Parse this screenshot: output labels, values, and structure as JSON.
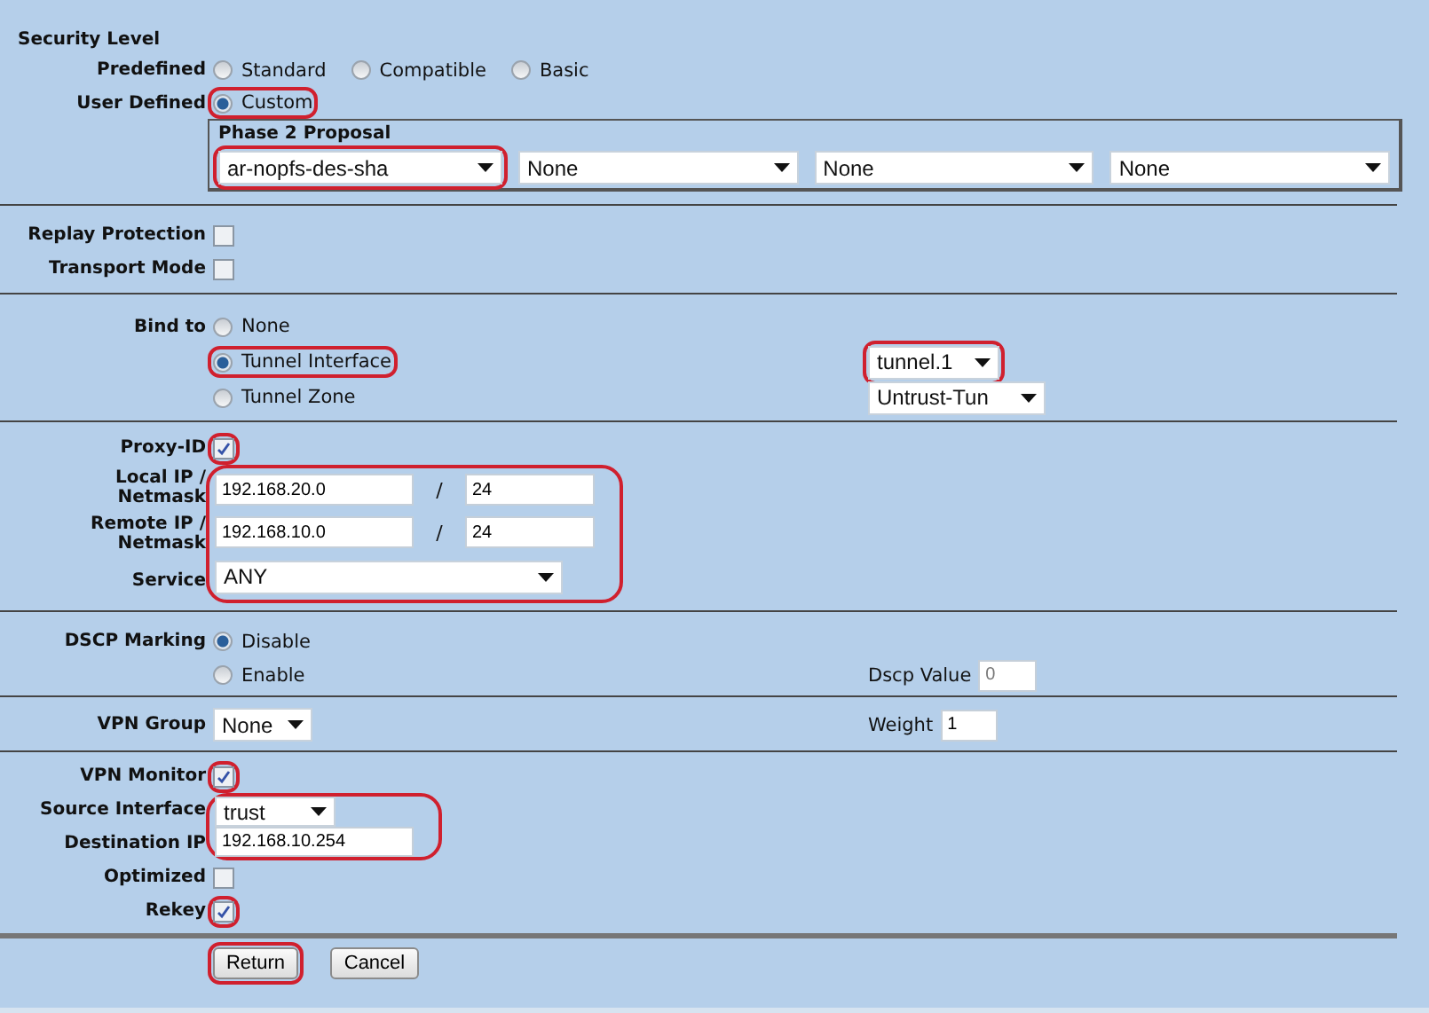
{
  "security_level": {
    "heading": "Security Level",
    "predefined": {
      "label": "Predefined",
      "options": [
        {
          "label": "Standard",
          "selected": false
        },
        {
          "label": "Compatible",
          "selected": false
        },
        {
          "label": "Basic",
          "selected": false
        }
      ]
    },
    "user_defined": {
      "label": "User Defined",
      "option": {
        "label": "Custom",
        "selected": true,
        "highlighted": true
      }
    },
    "phase2": {
      "title": "Phase 2 Proposal",
      "selects": [
        {
          "value": "ar-nopfs-des-sha",
          "highlighted": true
        },
        {
          "value": "None",
          "highlighted": false
        },
        {
          "value": "None",
          "highlighted": false
        },
        {
          "value": "None",
          "highlighted": false
        }
      ]
    }
  },
  "replay_protection": {
    "label": "Replay Protection",
    "checked": false
  },
  "transport_mode": {
    "label": "Transport Mode",
    "checked": false
  },
  "bind_to": {
    "label": "Bind to",
    "options": [
      {
        "label": "None",
        "selected": false,
        "highlighted": false
      },
      {
        "label": "Tunnel Interface",
        "selected": true,
        "highlighted": true,
        "select": {
          "value": "tunnel.1",
          "highlighted": true
        }
      },
      {
        "label": "Tunnel Zone",
        "selected": false,
        "highlighted": false,
        "select": {
          "value": "Untrust-Tun",
          "highlighted": false
        }
      }
    ]
  },
  "proxy_id": {
    "label": "Proxy-ID",
    "checked": true,
    "highlighted": true,
    "fields_highlighted": true,
    "local": {
      "label": "Local IP / Netmask",
      "ip": "192.168.20.0",
      "separator": "/",
      "mask": "24"
    },
    "remote": {
      "label": "Remote IP / Netmask",
      "ip": "192.168.10.0",
      "separator": "/",
      "mask": "24"
    },
    "service": {
      "label": "Service",
      "value": "ANY"
    }
  },
  "dscp": {
    "label": "DSCP Marking",
    "options": [
      {
        "label": "Disable",
        "selected": true
      },
      {
        "label": "Enable",
        "selected": false
      }
    ],
    "value_label": "Dscp Value",
    "value": "0",
    "value_disabled": true
  },
  "vpn_group": {
    "label": "VPN Group",
    "value": "None",
    "weight_label": "Weight",
    "weight": "1"
  },
  "vpn_monitor": {
    "label": "VPN Monitor",
    "checked": true,
    "highlighted": true
  },
  "monitor_fields": {
    "highlighted": true,
    "source_interface": {
      "label": "Source Interface",
      "value": "trust"
    },
    "destination_ip": {
      "label": "Destination IP",
      "value": "192.168.10.254"
    }
  },
  "optimized": {
    "label": "Optimized",
    "checked": false
  },
  "rekey": {
    "label": "Rekey",
    "checked": true,
    "highlighted": true
  },
  "buttons": [
    {
      "label": "Return",
      "highlighted": true
    },
    {
      "label": "Cancel",
      "highlighted": false
    }
  ]
}
